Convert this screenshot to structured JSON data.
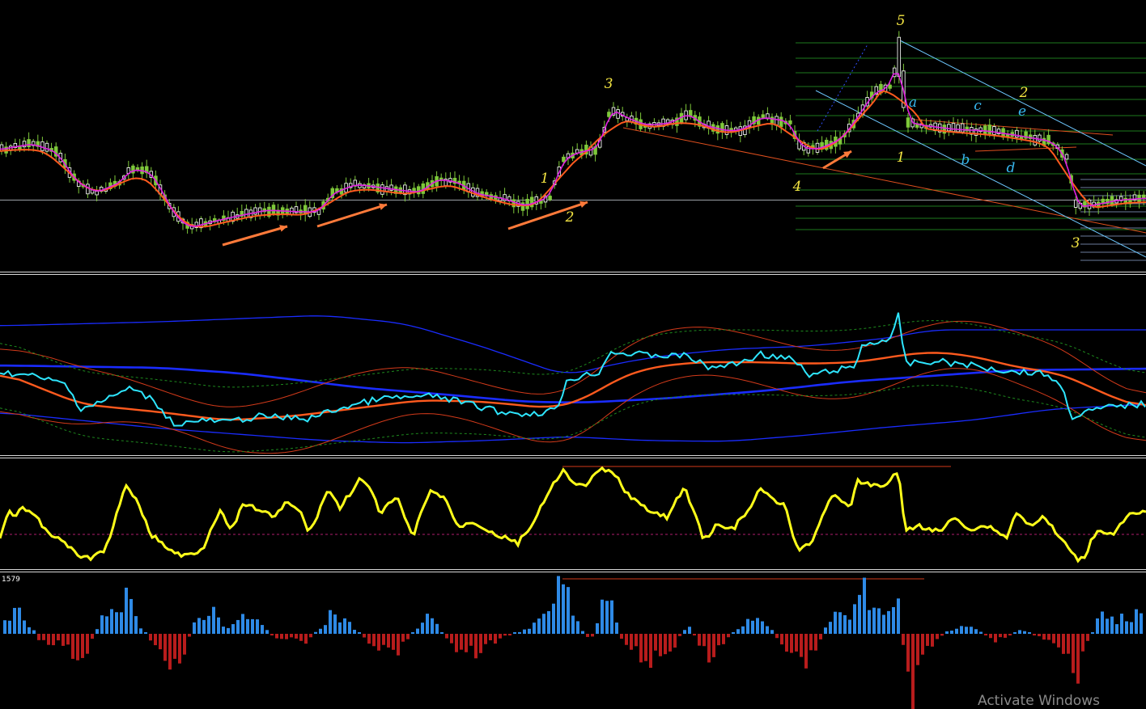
{
  "chart_data": [
    {
      "type": "candlestick",
      "panel": "price",
      "wave_labels": {
        "yellow": [
          "1",
          "2",
          "3",
          "4",
          "5",
          "1",
          "2",
          "3"
        ],
        "cyan": [
          "a",
          "b",
          "c",
          "d",
          "e"
        ]
      },
      "overlay_lines": [
        {
          "name": "",
          "color": "#ff5a1e"
        },
        {
          "name": "",
          "color": "#e020e0"
        }
      ],
      "annotations": {
        "trend_arrows": 4,
        "arrow_color": "#ff7a3a",
        "channel_color": "#6ec8ff",
        "fib_levels_color": "#1e7a1e"
      }
    },
    {
      "type": "line",
      "panel": "bands",
      "series": [
        {
          "color": "#2ee6ff"
        },
        {
          "color": "#ff5a1e"
        },
        {
          "color": "#1a2cff"
        },
        {
          "color": "#1a2cff"
        },
        {
          "color": "#d33a1a"
        },
        {
          "color": "#1e8a1e"
        }
      ]
    },
    {
      "type": "line",
      "panel": "oscillator",
      "series": [
        {
          "color": "#ffff1a"
        }
      ],
      "reference_lines": [
        "dashed-midline",
        "resistance-line"
      ]
    },
    {
      "type": "bar",
      "panel": "histogram",
      "label": "1579",
      "positive_color": "#2e8ae6",
      "negative_color": "#b81c1c"
    }
  ],
  "watermark": "Activate Windows"
}
